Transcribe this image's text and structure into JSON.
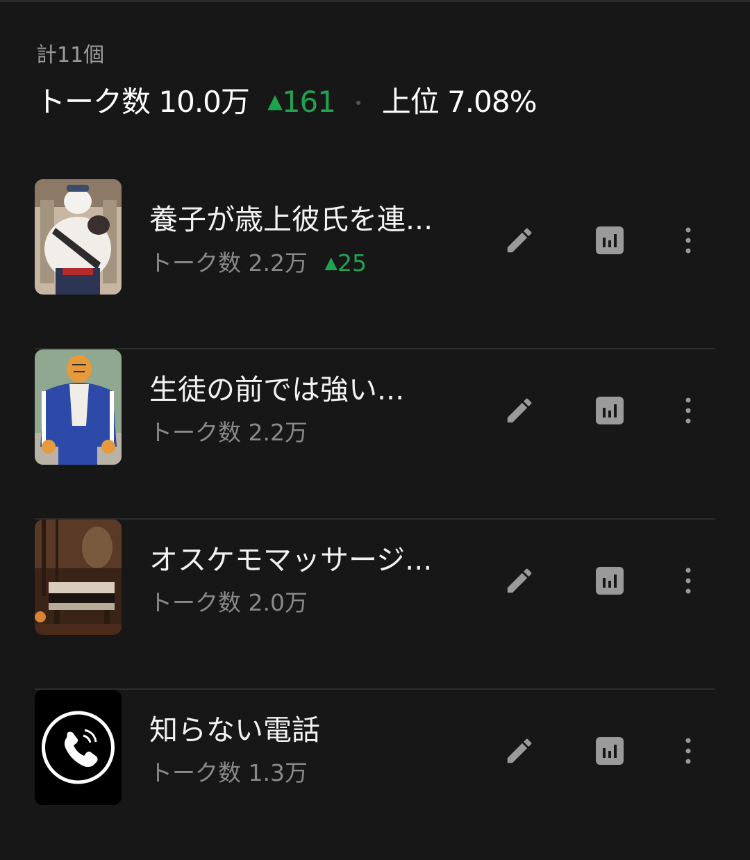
{
  "summary": {
    "total": "計11個",
    "talk_label": "トーク数",
    "talk_value": "10.0万",
    "talk_delta_icon": "up-triangle",
    "talk_delta_symbol": "▲",
    "talk_delta": "161",
    "rank_label": "上位",
    "rank_value": "7.08%"
  },
  "colors": {
    "background": "#171717",
    "positive": "#1fa34f",
    "muted_text": "#8a8a8a",
    "icon": "#9a9a9a"
  },
  "items": [
    {
      "title": "養子が歳上彼氏を連...",
      "talk_label": "トーク数",
      "talk_value": "2.2万",
      "delta_symbol": "▲",
      "delta": "25",
      "thumbnail": "muscular-white-wolf-character"
    },
    {
      "title": "生徒の前では強い...",
      "talk_label": "トーク数",
      "talk_value": "2.2万",
      "delta_symbol": "",
      "delta": "",
      "thumbnail": "tiger-in-blue-tracksuit"
    },
    {
      "title": "オスケモマッサージ...",
      "talk_label": "トーク数",
      "talk_value": "2.0万",
      "delta_symbol": "",
      "delta": "",
      "thumbnail": "dim-massage-room"
    },
    {
      "title": "知らない電話",
      "talk_label": "トーク数",
      "talk_value": "1.3万",
      "delta_symbol": "",
      "delta": "",
      "thumbnail": "phone-call-icon"
    }
  ],
  "actions": {
    "edit_icon": "pencil-icon",
    "stats_icon": "bar-chart-icon",
    "more_icon": "more-vertical-icon"
  }
}
